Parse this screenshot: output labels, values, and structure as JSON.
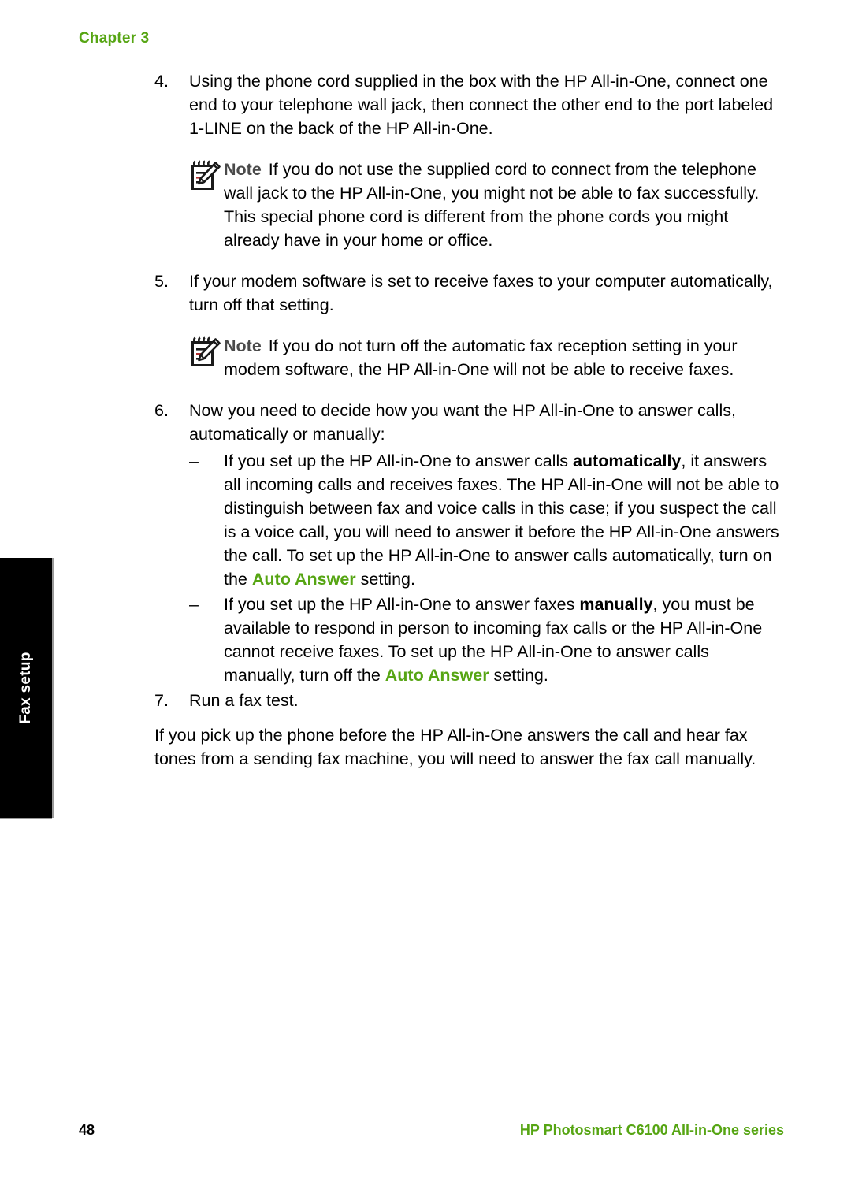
{
  "header": {
    "chapter_label": "Chapter 3"
  },
  "side_tab": {
    "label": "Fax setup"
  },
  "steps": [
    {
      "number": "4.",
      "text": "Using the phone cord supplied in the box with the HP All-in-One, connect one end to your telephone wall jack, then connect the other end to the port labeled 1-LINE on the back of the HP All-in-One."
    },
    {
      "number": "5.",
      "text": "If your modem software is set to receive faxes to your computer automatically, turn off that setting."
    },
    {
      "number": "6.",
      "text": "Now you need to decide how you want the HP All-in-One to answer calls, automatically or manually:"
    },
    {
      "number": "7.",
      "text": "Run a fax test."
    }
  ],
  "notes": [
    {
      "label": "Note",
      "icon": "note-pencil-icon",
      "text": "If you do not use the supplied cord to connect from the telephone wall jack to the HP All-in-One, you might not be able to fax successfully. This special phone cord is different from the phone cords you might already have in your home or office."
    },
    {
      "label": "Note",
      "icon": "note-pencil-icon",
      "text": "If you do not turn off the automatic fax reception setting in your modem software, the HP All-in-One will not be able to receive faxes."
    }
  ],
  "subitems": [
    {
      "dash": "–",
      "part1": "If you set up the HP All-in-One to answer calls ",
      "bold1": "automatically",
      "part2": ", it answers all incoming calls and receives faxes. The HP All-in-One will not be able to distinguish between fax and voice calls in this case; if you suspect the call is a voice call, you will need to answer it before the HP All-in-One answers the call. To set up the HP All-in-One to answer calls automatically, turn on the ",
      "ui_term": "Auto Answer",
      "part3": " setting."
    },
    {
      "dash": "–",
      "part1": "If you set up the HP All-in-One to answer faxes ",
      "bold1": "manually",
      "part2": ", you must be available to respond in person to incoming fax calls or the HP All-in-One cannot receive faxes. To set up the HP All-in-One to answer calls manually, turn off the ",
      "ui_term": "Auto Answer",
      "part3": " setting."
    }
  ],
  "closing_paragraph": {
    "text": "If you pick up the phone before the HP All-in-One answers the call and hear fax tones from a sending fax machine, you will need to answer the fax call manually."
  },
  "footer": {
    "page_number": "48",
    "product_name": "HP Photosmart C6100 All-in-One series"
  },
  "colors": {
    "accent_green": "#56a513",
    "note_label_gray": "#4a4a4a",
    "tab_background": "#000000"
  }
}
